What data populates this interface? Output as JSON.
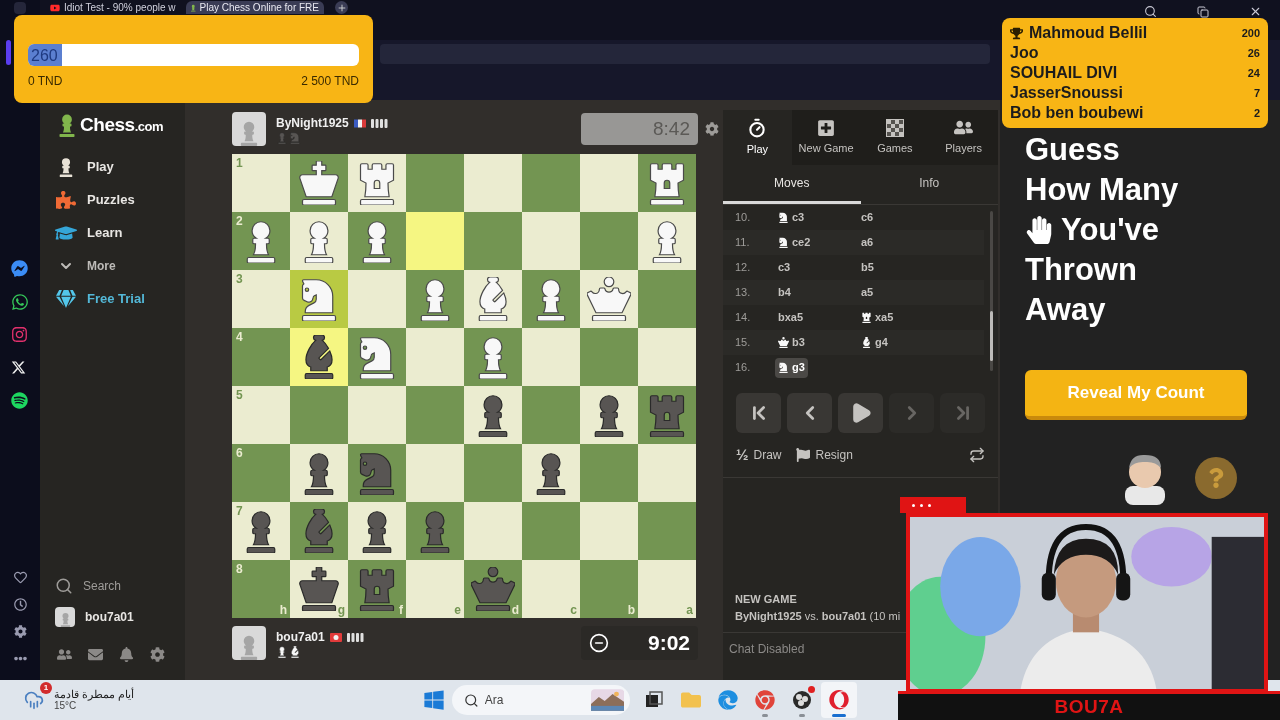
{
  "browser": {
    "tabs": [
      {
        "title": "Idiot Test - 90% people w",
        "kind": "video",
        "selected": false
      },
      {
        "title": "Play Chess Online for FRE",
        "kind": "chess",
        "selected": true
      }
    ]
  },
  "donation": {
    "value": "260",
    "level": 0.104,
    "min": "0 TND",
    "max": "2 500 TND"
  },
  "leaderboard": [
    {
      "name": "Mahmoud Bellil",
      "count": "200",
      "trophy": true
    },
    {
      "name": "Joo",
      "count": "26",
      "trophy": false
    },
    {
      "name": "SOUHAIL DIVI",
      "count": "24",
      "trophy": false
    },
    {
      "name": "JasserSnoussi",
      "count": "7",
      "trophy": false
    },
    {
      "name": "Bob ben boubewi",
      "count": "2",
      "trophy": false
    }
  ],
  "sidebar": {
    "logo": {
      "name": "Chess",
      "suffix": ".com"
    },
    "items": [
      {
        "label": "Play",
        "kind": "play"
      },
      {
        "label": "Puzzles",
        "kind": "puzzles"
      },
      {
        "label": "Learn",
        "kind": "learn"
      },
      {
        "label": "More",
        "kind": "more"
      },
      {
        "label": "Free Trial",
        "kind": "trial"
      }
    ],
    "search": "Search",
    "user": "bou7a01"
  },
  "players": [
    {
      "name": "ByNight1925",
      "captured": [
        {
          "kind": "pawn",
          "white": false
        },
        {
          "kind": "knight",
          "white": false
        }
      ],
      "clock": {
        "time": "8:42",
        "active": false
      }
    },
    {
      "name": "bou7a01",
      "captured": [
        {
          "kind": "pawn",
          "white": true
        },
        {
          "kind": "bishop",
          "white": true
        }
      ],
      "clock": {
        "time": "9:02",
        "active": true
      }
    }
  ],
  "board": {
    "ranks": [
      "1",
      "2",
      "3",
      "4",
      "5",
      "6",
      "7",
      "8"
    ],
    "files": [
      "h",
      "g",
      "f",
      "e",
      "d",
      "c",
      "b",
      "a"
    ],
    "rows": [
      [
        {
          "highlighted": false
        },
        {
          "kind": "king",
          "white": true,
          "highlighted": false
        },
        {
          "kind": "rook",
          "white": true,
          "highlighted": false
        },
        {
          "highlighted": false
        },
        {
          "highlighted": false
        },
        {
          "highlighted": false
        },
        {
          "highlighted": false
        },
        {
          "kind": "rook",
          "white": true,
          "highlighted": false
        }
      ],
      [
        {
          "kind": "pawn",
          "white": true,
          "highlighted": false
        },
        {
          "kind": "pawn",
          "white": true,
          "highlighted": false
        },
        {
          "kind": "pawn",
          "white": true,
          "highlighted": false
        },
        {
          "highlighted": true
        },
        {
          "highlighted": false
        },
        {
          "highlighted": false
        },
        {
          "highlighted": false
        },
        {
          "kind": "pawn",
          "white": true,
          "highlighted": false
        }
      ],
      [
        {
          "highlighted": false
        },
        {
          "kind": "knight",
          "white": true,
          "highlighted": true
        },
        {
          "highlighted": false
        },
        {
          "kind": "pawn",
          "white": true,
          "highlighted": false
        },
        {
          "kind": "bishop",
          "white": true,
          "highlighted": false
        },
        {
          "kind": "pawn",
          "white": true,
          "highlighted": false
        },
        {
          "kind": "queen",
          "white": true,
          "highlighted": false
        },
        {
          "highlighted": false
        }
      ],
      [
        {
          "highlighted": false
        },
        {
          "kind": "bishop",
          "white": false,
          "highlighted": true
        },
        {
          "kind": "knight",
          "white": true,
          "highlighted": false
        },
        {
          "highlighted": false
        },
        {
          "kind": "pawn",
          "white": true,
          "highlighted": false
        },
        {
          "highlighted": false
        },
        {
          "highlighted": false
        },
        {
          "highlighted": false
        }
      ],
      [
        {
          "highlighted": false
        },
        {
          "highlighted": false
        },
        {
          "highlighted": false
        },
        {
          "highlighted": false
        },
        {
          "kind": "pawn",
          "white": false,
          "highlighted": false
        },
        {
          "highlighted": false
        },
        {
          "kind": "pawn",
          "white": false,
          "highlighted": false
        },
        {
          "kind": "rook",
          "white": false,
          "highlighted": false
        }
      ],
      [
        {
          "highlighted": false
        },
        {
          "kind": "pawn",
          "white": false,
          "highlighted": false
        },
        {
          "kind": "knight",
          "white": false,
          "highlighted": false
        },
        {
          "highlighted": false
        },
        {
          "highlighted": false
        },
        {
          "kind": "pawn",
          "white": false,
          "highlighted": false
        },
        {
          "highlighted": false
        },
        {
          "highlighted": false
        }
      ],
      [
        {
          "kind": "pawn",
          "white": false,
          "highlighted": false
        },
        {
          "kind": "bishop",
          "white": false,
          "highlighted": false
        },
        {
          "kind": "pawn",
          "white": false,
          "highlighted": false
        },
        {
          "kind": "pawn",
          "white": false,
          "highlighted": false
        },
        {
          "highlighted": false
        },
        {
          "highlighted": false
        },
        {
          "highlighted": false
        },
        {
          "highlighted": false
        }
      ],
      [
        {
          "highlighted": false
        },
        {
          "kind": "king",
          "white": false,
          "highlighted": false
        },
        {
          "kind": "rook",
          "white": false,
          "highlighted": false
        },
        {
          "highlighted": false
        },
        {
          "kind": "queen",
          "white": false,
          "highlighted": false
        },
        {
          "highlighted": false
        },
        {
          "highlighted": false
        },
        {
          "highlighted": false
        }
      ]
    ]
  },
  "panel": {
    "tabs": [
      {
        "label": "Play",
        "kind": "play",
        "selected": true
      },
      {
        "label": "New Game",
        "kind": "new",
        "selected": false
      },
      {
        "label": "Games",
        "kind": "games",
        "selected": false
      },
      {
        "label": "Players",
        "kind": "players",
        "selected": false
      }
    ],
    "subtabs": [
      {
        "label": "Moves",
        "selected": true
      },
      {
        "label": "Info",
        "selected": false
      }
    ],
    "moves": [
      {
        "number": "10.",
        "white": {
          "kind": "knight",
          "san": "c3",
          "selected": false
        },
        "black": {
          "san": "c6",
          "selected": false
        }
      },
      {
        "number": "11.",
        "white": {
          "kind": "knight",
          "san": "ce2",
          "selected": false
        },
        "black": {
          "san": "a6",
          "selected": false
        }
      },
      {
        "number": "12.",
        "white": {
          "san": "c3",
          "selected": false
        },
        "black": {
          "san": "b5",
          "selected": false
        }
      },
      {
        "number": "13.",
        "white": {
          "san": "b4",
          "selected": false
        },
        "black": {
          "san": "a5",
          "selected": false
        }
      },
      {
        "number": "14.",
        "white": {
          "san": "bxa5",
          "selected": false
        },
        "black": {
          "kind": "rook",
          "san": "xa5",
          "selected": false
        }
      },
      {
        "number": "15.",
        "white": {
          "kind": "queen",
          "san": "b3",
          "selected": false
        },
        "black": {
          "kind": "bishop",
          "san": "g4",
          "selected": false
        }
      },
      {
        "number": "16.",
        "white": {
          "kind": "knight",
          "san": "g3",
          "selected": true
        }
      }
    ],
    "controls": [
      {
        "kind": "first",
        "disabled": false
      },
      {
        "kind": "prev",
        "disabled": false
      },
      {
        "kind": "play",
        "disabled": false
      },
      {
        "kind": "next",
        "disabled": true
      },
      {
        "kind": "last",
        "disabled": true
      }
    ],
    "draw": {
      "symbol": "½",
      "label": "Draw"
    },
    "resign": "Resign",
    "new_game": {
      "heading": "NEW GAME",
      "players": "**ByNight1925** vs. **bou7a01** (10 mi"
    },
    "chat": "Chat Disabled"
  },
  "promo": {
    "headline": [
      {
        "text": "Guess",
        "hand": false
      },
      {
        "text": "How Many",
        "hand": false
      },
      {
        "text": "You've",
        "hand": true
      },
      {
        "text": "Thrown",
        "hand": false
      },
      {
        "text": "Away",
        "hand": false
      }
    ],
    "button": "Reveal My Count"
  },
  "webcam": {
    "label": "BOU7A"
  },
  "taskbar": {
    "weather": {
      "badge": "1",
      "text": "أيام ممطرة قادمة",
      "temp": "15°C"
    },
    "search": {
      "placeholder": "Ara"
    },
    "apps": [
      {
        "kind": "taskview",
        "running": false,
        "selected": false,
        "alert": false
      },
      {
        "kind": "explorer",
        "running": false,
        "selected": false,
        "alert": false
      },
      {
        "kind": "edge",
        "running": false,
        "selected": false,
        "alert": false
      },
      {
        "kind": "chrome",
        "running": true,
        "selected": false,
        "alert": false
      },
      {
        "kind": "obs",
        "running": true,
        "selected": false,
        "alert": true
      },
      {
        "kind": "opera",
        "running": true,
        "selected": true,
        "alert": false
      }
    ]
  }
}
